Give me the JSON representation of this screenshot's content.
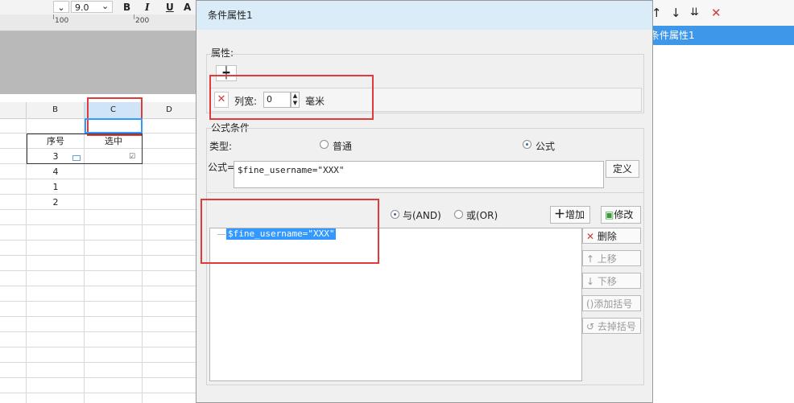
{
  "toolbar": {
    "font_size": "9.0",
    "bold": "B",
    "italic": "I",
    "underline": "U",
    "font_color": "A"
  },
  "ruler": {
    "marks": [
      "100",
      "200"
    ]
  },
  "sheet": {
    "columns": [
      "B",
      "C",
      "D"
    ],
    "header_row": [
      "序号",
      "选中"
    ],
    "rows": [
      "3",
      "4",
      "1",
      "2"
    ]
  },
  "dialog": {
    "title": "条件属性1",
    "attribute": {
      "label": "属性:",
      "column_width_label": "列宽:",
      "column_width_value": "0",
      "unit": "毫米"
    },
    "formula_condition": {
      "label": "公式条件",
      "type_label": "类型:",
      "option_normal": "普通",
      "option_formula": "公式",
      "formula_label": "公式=",
      "formula_value": "$fine_username=\"XXX\"",
      "define_button": "定义",
      "and_label": "与(AND)",
      "or_label": "或(OR)",
      "add_button": "增加",
      "modify_button": "修改",
      "condition_items": [
        "$fine_username=\"XXX\""
      ],
      "delete_button": "删除",
      "move_up_button": "上移",
      "move_down_button": "下移",
      "add_bracket_button": "添加括号",
      "remove_bracket_button": "去掉括号"
    }
  },
  "right_panel": {
    "selected_item": "条件属性1"
  },
  "colors": {
    "accent": "#3e97e8",
    "highlight_red": "#e03a3a",
    "selection_blue": "#3399ff"
  }
}
